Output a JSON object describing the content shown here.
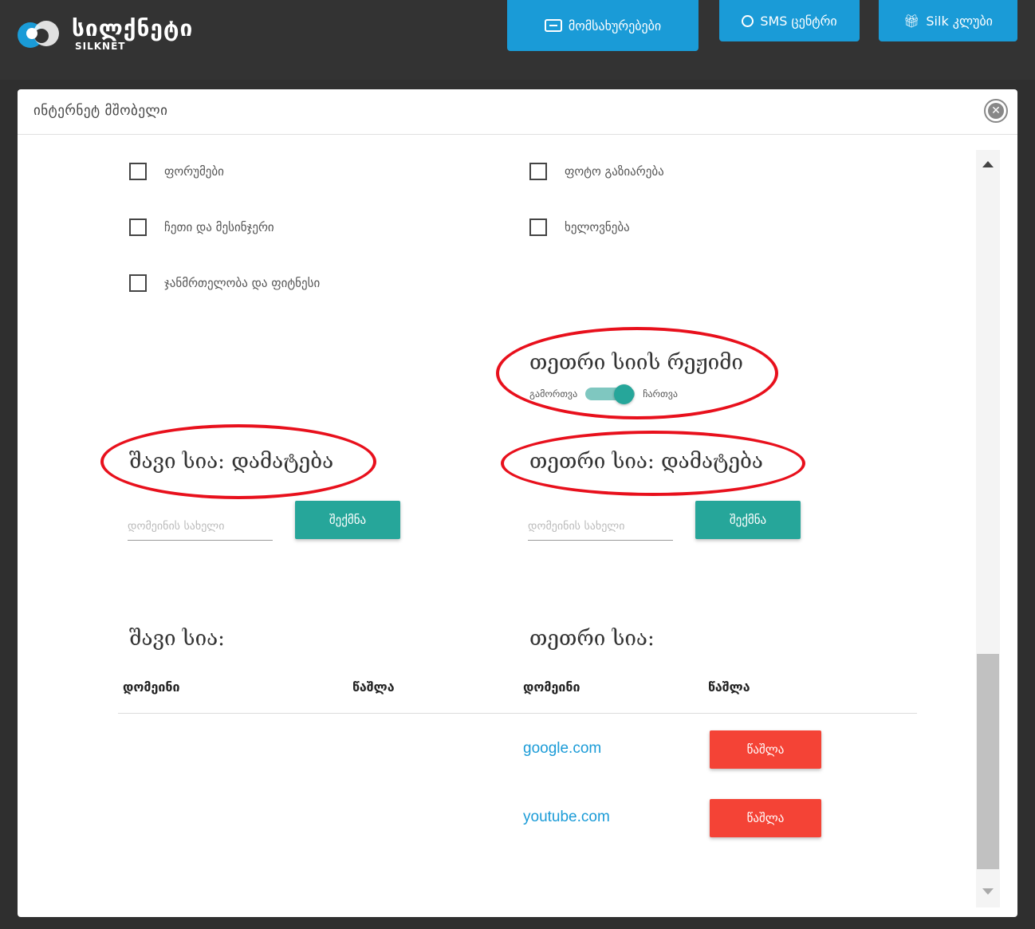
{
  "topbar": {
    "logo_name": "სილქნეტი",
    "logo_sub": "SILKNET",
    "services_label": "მომსახურებები",
    "sms_label": "SMS ცენტრი",
    "club_label": "Silk კლუბი"
  },
  "modal": {
    "title": "ინტერნეტ მშობელი",
    "close_symbol": "✕"
  },
  "categories": [
    {
      "label": "ფორუმები",
      "checked": false
    },
    {
      "label": "ფოტო გაზიარება",
      "checked": false
    },
    {
      "label": "ჩეთი და მესინჯერი",
      "checked": false
    },
    {
      "label": "ხელოვნება",
      "checked": false
    },
    {
      "label": "ჯანმრთელობა და ფიტნესი",
      "checked": false
    }
  ],
  "whitelist_mode": {
    "title": "თეთრი სიის რეჟიმი",
    "off_label": "გამორთვა",
    "on_label": "ჩართვა",
    "enabled": true
  },
  "blacklist_add": {
    "title": "შავი სია: დამატება",
    "placeholder": "დომეინის სახელი",
    "button": "შექმნა"
  },
  "whitelist_add": {
    "title": "თეთრი სია: დამატება",
    "placeholder": "დომეინის სახელი",
    "button": "შექმნა"
  },
  "blacklist": {
    "title": "შავი სია:",
    "col_domain": "დომეინი",
    "col_delete": "წაშლა",
    "items": []
  },
  "whitelist": {
    "title": "თეთრი სია:",
    "col_domain": "დომეინი",
    "col_delete": "წაშლა",
    "items": [
      {
        "domain": "google.com",
        "delete_label": "წაშლა"
      },
      {
        "domain": "youtube.com",
        "delete_label": "წაშლა"
      }
    ]
  },
  "colors": {
    "accent_blue": "#1a9bd7",
    "teal": "#26a69a",
    "danger": "#f44336",
    "annotation_red": "#e8101c"
  }
}
